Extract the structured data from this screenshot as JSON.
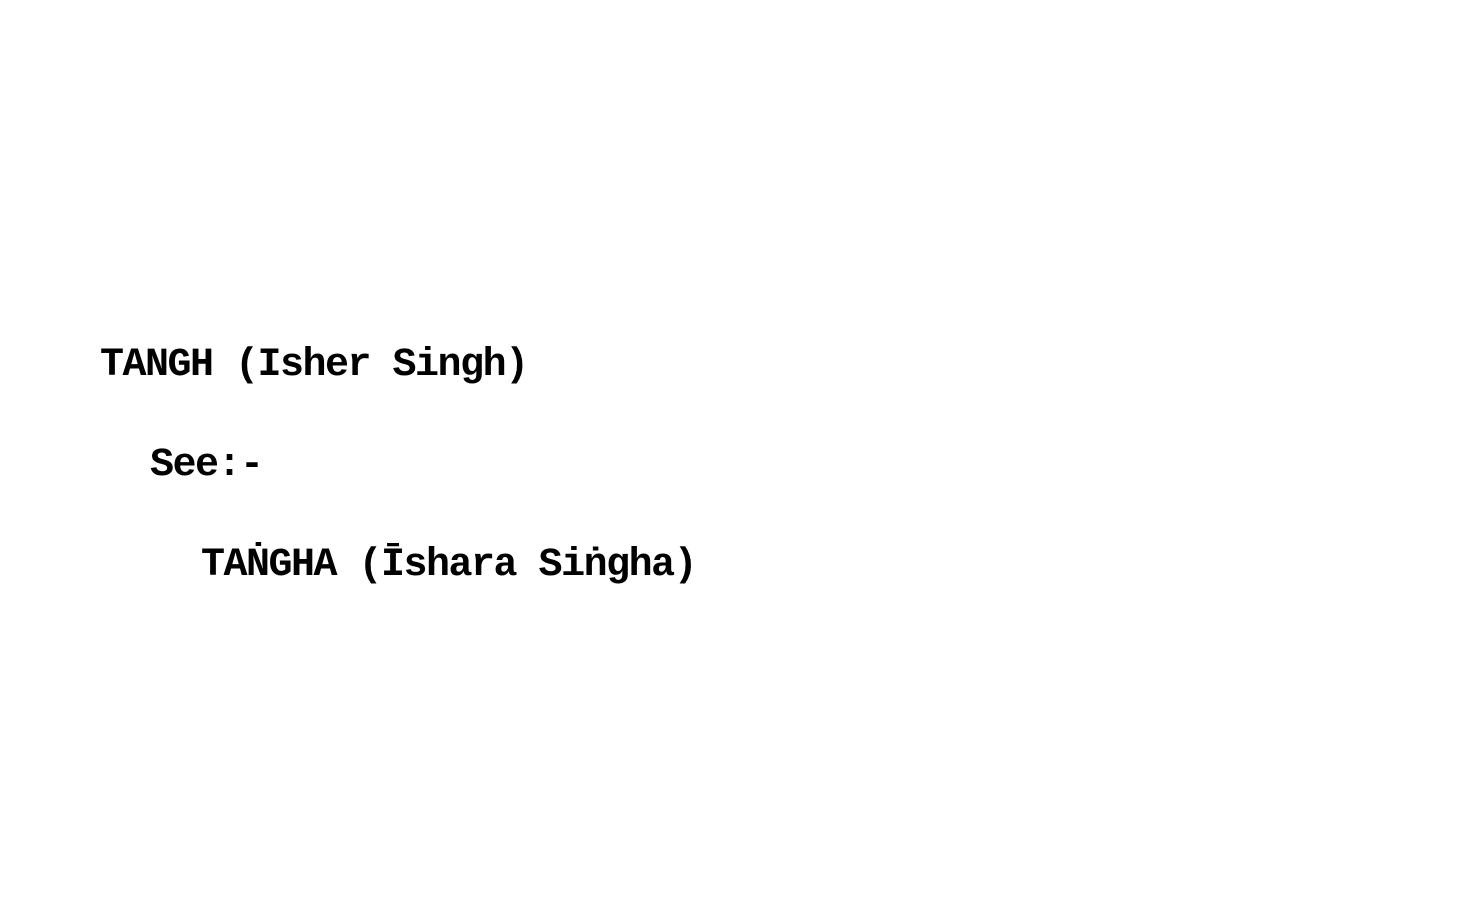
{
  "card": {
    "heading": "TANGH (Isher Singh)",
    "see_label": "See:-",
    "reference": "TAṄGHA (Īshara Siṅgha)"
  }
}
